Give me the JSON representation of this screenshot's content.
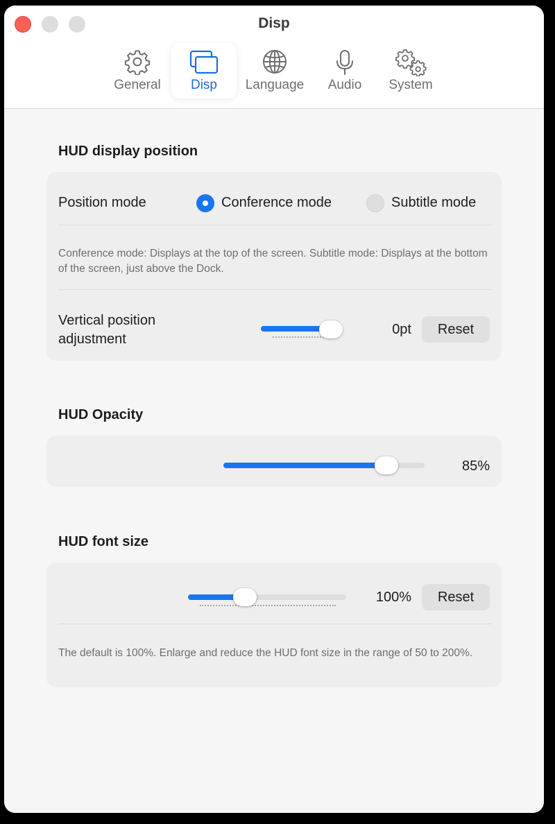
{
  "window": {
    "title": "Disp"
  },
  "tabs": [
    {
      "label": "General",
      "icon": "gear-icon"
    },
    {
      "label": "Disp",
      "icon": "displays-icon",
      "active": true
    },
    {
      "label": "Language",
      "icon": "globe-icon"
    },
    {
      "label": "Audio",
      "icon": "microphone-icon"
    },
    {
      "label": "System",
      "icon": "gears-icon"
    }
  ],
  "colors": {
    "accent": "#1a75f0",
    "close": "#fe5f57",
    "card": "#eeeeee"
  },
  "hud_position": {
    "title": "HUD display position",
    "mode_label": "Position mode",
    "options": [
      {
        "label": "Conference mode",
        "selected": true
      },
      {
        "label": "Subtitle mode",
        "selected": false
      }
    ],
    "description": "Conference mode: Displays at the top of the screen. Subtitle mode: Displays at the bottom of the screen, just above the Dock.",
    "vertical_label": "Vertical position adjustment",
    "vertical_value": "0pt",
    "vertical_level": 1.0,
    "reset_label": "Reset"
  },
  "hud_opacity": {
    "title": "HUD Opacity",
    "value": "85%",
    "level": 0.85
  },
  "hud_font": {
    "title": "HUD font size",
    "value": "100%",
    "level": 0.333,
    "reset_label": "Reset",
    "description": "The default is 100%. Enlarge and reduce the HUD font size in the range of 50 to 200%."
  }
}
